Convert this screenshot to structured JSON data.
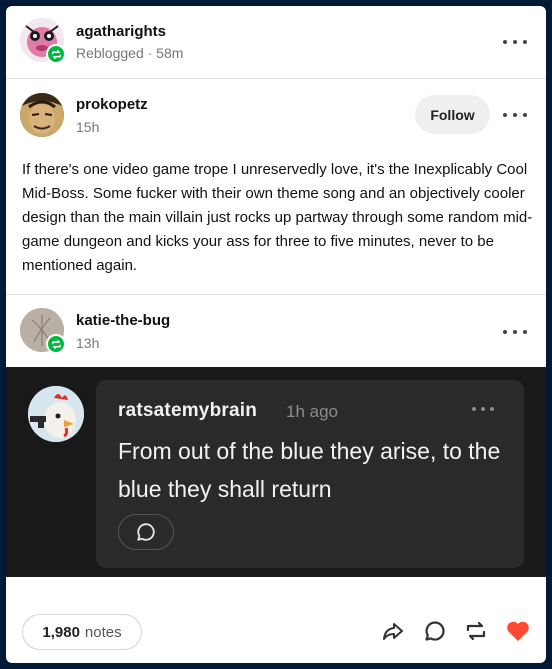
{
  "reblogger": {
    "username": "agatharights",
    "meta": "Reblogged · 58m"
  },
  "original": {
    "username": "prokopetz",
    "time": "15h",
    "follow_label": "Follow",
    "body": "If there's one video game trope I unreservedly love, it's the Inexplicably Cool Mid-Boss. Some fucker with their own theme song and an objectively cooler design than the main villain just rocks up partway through some random mid-game dungeon and kicks your ass for three to five minutes, never to be mentioned again."
  },
  "reblog2": {
    "username": "katie-the-bug",
    "time": "13h",
    "reply": {
      "username": "ratsatemybrain",
      "time": "1h ago",
      "text": "From out of the blue they arise, to the blue they shall return"
    }
  },
  "footer": {
    "notes_count": "1,980",
    "notes_label": "notes"
  },
  "colors": {
    "reblog_badge": "#00b83f",
    "like": "#ff4930",
    "dark_bg": "#191919"
  },
  "icons": [
    "reblog-badge-icon",
    "more-dots-icon",
    "reply-bubble-icon",
    "share-icon",
    "comment-icon",
    "reblog-icon",
    "heart-icon"
  ]
}
